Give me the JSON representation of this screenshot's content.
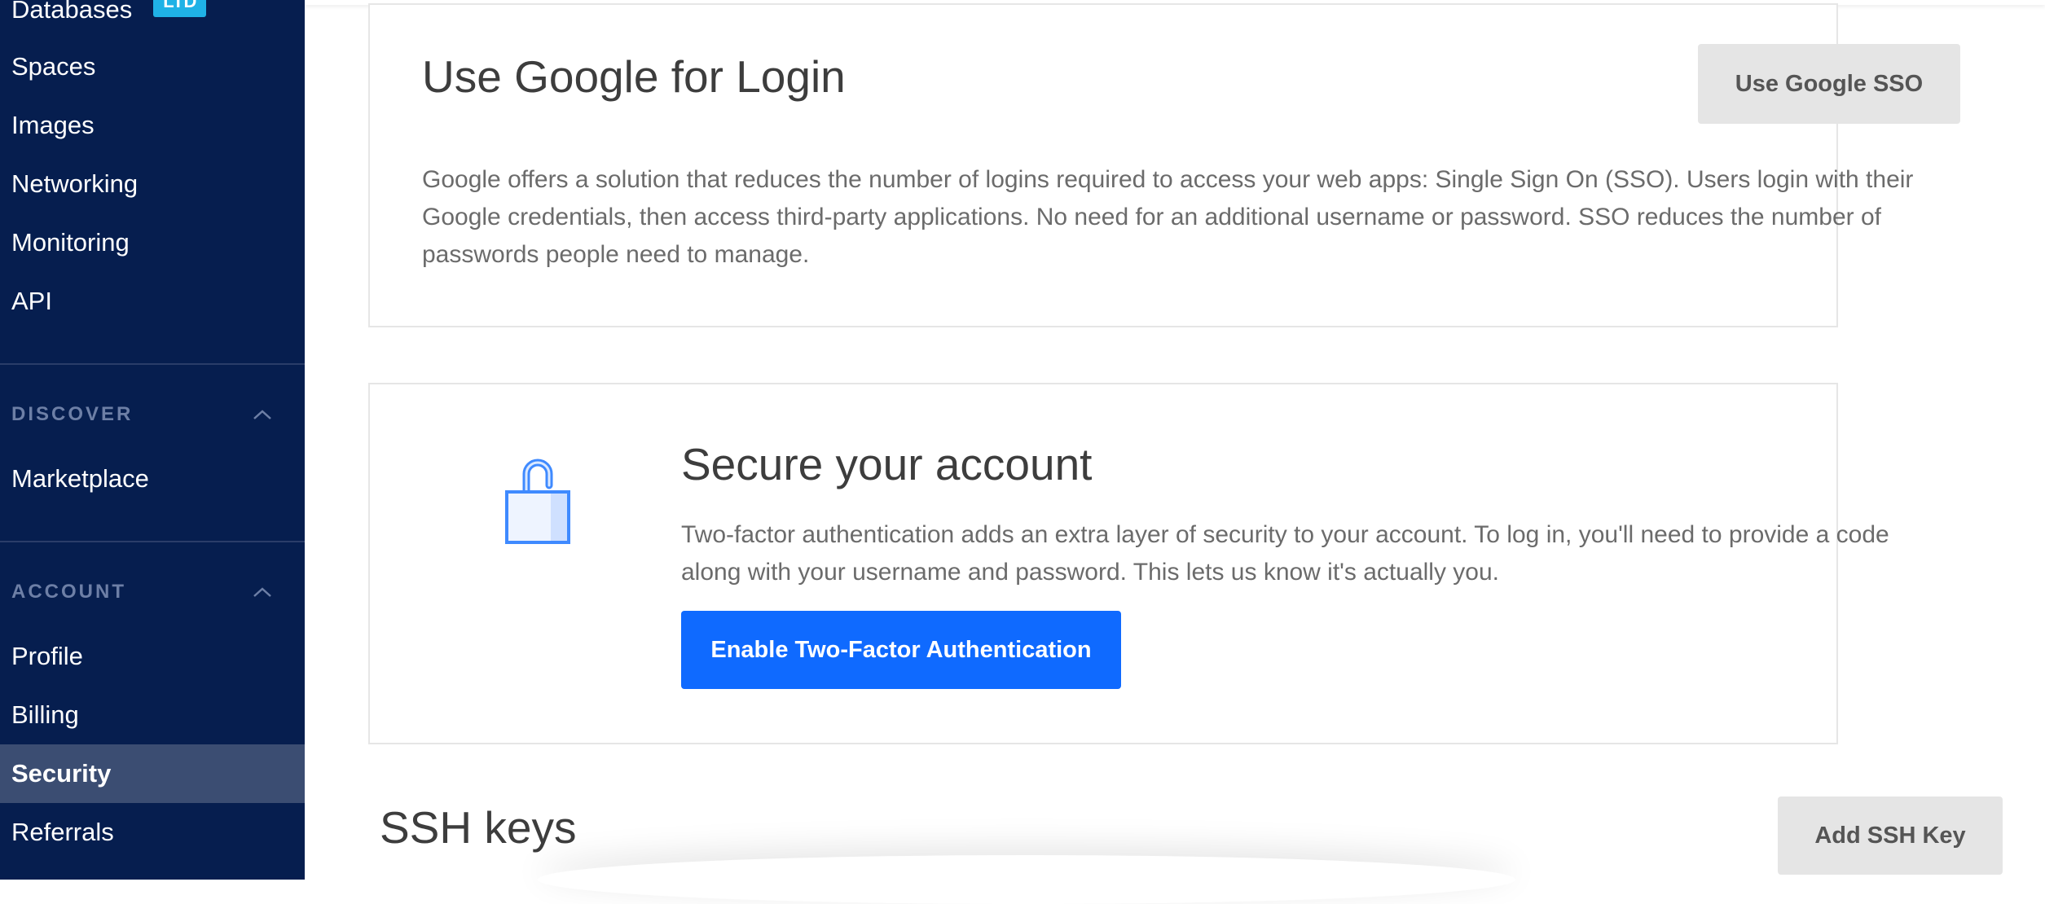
{
  "sidebar": {
    "nav_items": [
      {
        "label": "Databases",
        "badge": "LTD"
      },
      {
        "label": "Spaces"
      },
      {
        "label": "Images"
      },
      {
        "label": "Networking"
      },
      {
        "label": "Monitoring"
      },
      {
        "label": "API"
      }
    ],
    "discover": {
      "header": "DISCOVER",
      "items": [
        {
          "label": "Marketplace"
        }
      ]
    },
    "account": {
      "header": "ACCOUNT",
      "items": [
        {
          "label": "Profile"
        },
        {
          "label": "Billing"
        },
        {
          "label": "Security",
          "active": true
        },
        {
          "label": "Referrals"
        }
      ]
    },
    "colors": {
      "background": "#061e4f",
      "active": "#3b4d72",
      "badge": "#1fb2e6"
    }
  },
  "google_login": {
    "title": "Use Google for Login",
    "button_label": "Use Google SSO",
    "description": "Google offers a solution that reduces the number of logins required to access your web apps: Single Sign On (SSO). Users login with their Google credentials, then access third-party applications. No need for an additional username or password. SSO reduces the number of passwords people need to manage."
  },
  "two_factor": {
    "icon": "unlocked-padlock-icon",
    "title": "Secure your account",
    "description": "Two-factor authentication adds an extra layer of security to your account. To log in, you'll need to provide a code along with your username and password. This lets us know it's actually you.",
    "button_label": "Enable Two-Factor Authentication",
    "button_color": "#0f6aff"
  },
  "ssh_keys": {
    "title": "SSH keys",
    "button_label": "Add SSH Key"
  }
}
